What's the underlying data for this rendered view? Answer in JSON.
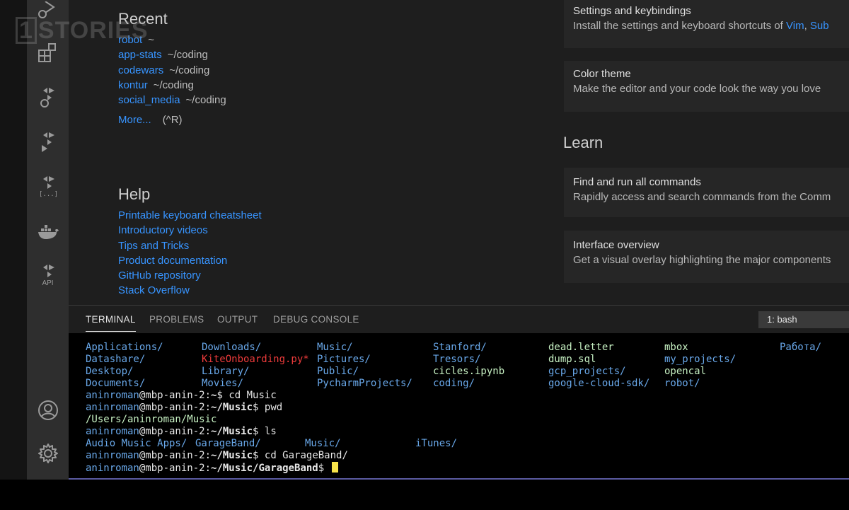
{
  "watermark": {
    "box": "1",
    "text": "STORIES"
  },
  "activity_bar": {
    "icons": [
      {
        "name": "run-debug-icon"
      },
      {
        "name": "extensions-icon"
      },
      {
        "name": "kite-icon"
      },
      {
        "name": "kite-run-icon"
      },
      {
        "name": "kite-brackets-icon"
      },
      {
        "name": "docker-icon"
      },
      {
        "name": "api-icon",
        "label": "API"
      },
      {
        "name": "account-icon"
      },
      {
        "name": "settings-gear-icon"
      }
    ]
  },
  "welcome": {
    "recent": {
      "title": "Recent",
      "items": [
        {
          "name": "robot",
          "path": "~"
        },
        {
          "name": "app-stats",
          "path": "~/coding"
        },
        {
          "name": "codewars",
          "path": "~/coding"
        },
        {
          "name": "kontur",
          "path": "~/coding"
        },
        {
          "name": "social_media",
          "path": "~/coding"
        }
      ],
      "more_label": "More...",
      "more_shortcut": "(^R)"
    },
    "help": {
      "title": "Help",
      "links": [
        "Printable keyboard cheatsheet",
        "Introductory videos",
        "Tips and Tricks",
        "Product documentation",
        "GitHub repository",
        "Stack Overflow"
      ]
    },
    "customize_cards": [
      {
        "title": "Settings and keybindings",
        "desc_prefix": "Install the settings and keyboard shortcuts of ",
        "desc_links": [
          "Vim",
          "Sub"
        ],
        "desc_sep": ", "
      },
      {
        "title": "Color theme",
        "desc": "Make the editor and your code look the way you love"
      }
    ],
    "learn": {
      "title": "Learn",
      "cards": [
        {
          "title": "Find and run all commands",
          "desc": "Rapidly access and search commands from the Comm"
        },
        {
          "title": "Interface overview",
          "desc": "Get a visual overlay highlighting the major components"
        }
      ]
    }
  },
  "panel": {
    "tabs": [
      "TERMINAL",
      "PROBLEMS",
      "OUTPUT",
      "DEBUG CONSOLE"
    ],
    "active_tab": "TERMINAL",
    "terminal_selector": "1: bash"
  },
  "terminal": {
    "ls_grid": [
      [
        "Applications/",
        "Downloads/",
        "Music/",
        "Stanford/",
        "dead.letter",
        "mbox",
        "Работа/"
      ],
      [
        "Datashare/",
        "KiteOnboarding.py*",
        "Pictures/",
        "Tresors/",
        "dump.sql",
        "my_projects/",
        ""
      ],
      [
        "Desktop/",
        "Library/",
        "Public/",
        "cicles.ipynb",
        "gcp_projects/",
        "opencal",
        ""
      ],
      [
        "Documents/",
        "Movies/",
        "PycharmProjects/",
        "coding/",
        "google-cloud-sdk/",
        "robot/",
        ""
      ]
    ],
    "user": "aninroman",
    "host": "@mbp-anin-2:",
    "session": [
      {
        "kind": "prompt",
        "cwd": "~",
        "cmd": " cd Music"
      },
      {
        "kind": "prompt",
        "cwd": "~/Music",
        "cmd": " pwd"
      },
      {
        "kind": "output",
        "text": "/Users/aninroman/Music"
      },
      {
        "kind": "prompt",
        "cwd": "~/Music",
        "cmd": " ls"
      },
      {
        "kind": "dirs",
        "items": [
          "Audio Music Apps/",
          "GarageBand/",
          "Music/",
          "iTunes/"
        ]
      },
      {
        "kind": "prompt",
        "cwd": "~/Music",
        "cmd": " cd GarageBand/"
      },
      {
        "kind": "prompt",
        "cwd": "~/Music/GarageBand",
        "cmd": " ",
        "cursor": true
      }
    ]
  }
}
